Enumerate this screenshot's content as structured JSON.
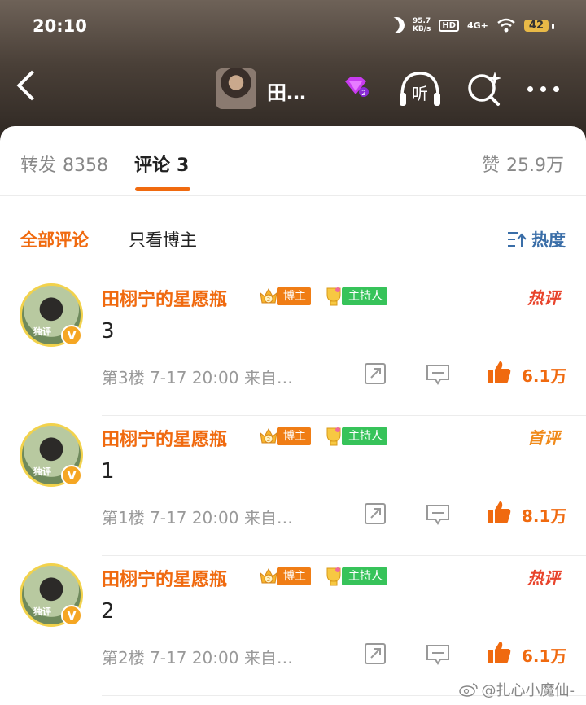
{
  "status_bar": {
    "time": "20:10",
    "net_speed_value": "95.7",
    "net_speed_unit": "KB/s",
    "hd": "HD",
    "signal": "4G+",
    "battery": "42"
  },
  "nav": {
    "title": "田…",
    "icons": [
      "back-icon",
      "diamond-icon",
      "listen-icon",
      "search-icon",
      "more-icon"
    ],
    "listen_label": "听"
  },
  "tabs": {
    "repost_label": "转发",
    "repost_count": "8358",
    "comment_label": "评论",
    "comment_count": "3",
    "like_label": "赞",
    "like_count": "25.9万"
  },
  "filters": {
    "all": "全部评论",
    "owner_only": "只看博主",
    "sort": "热度"
  },
  "comments": [
    {
      "name": "田栩宁的星愿瓶",
      "badge_blogger": "博主",
      "badge_host": "主持人",
      "tag": "热评",
      "tag_color": "#e8442c",
      "body": "3",
      "meta": "第3楼 7-17 20:00 来自…",
      "likes": "6.1万",
      "avatar_text": "独评"
    },
    {
      "name": "田栩宁的星愿瓶",
      "badge_blogger": "博主",
      "badge_host": "主持人",
      "tag": "首评",
      "tag_color": "#f08a1a",
      "body": "1",
      "meta": "第1楼 7-17 20:00 来自…",
      "likes": "8.1万",
      "avatar_text": "独评"
    },
    {
      "name": "田栩宁的星愿瓶",
      "badge_blogger": "博主",
      "badge_host": "主持人",
      "tag": "热评",
      "tag_color": "#e8442c",
      "body": "2",
      "meta": "第2楼 7-17 20:00 来自…",
      "likes": "6.1万",
      "avatar_text": "独评"
    }
  ],
  "watermark": "@扎心小魔仙-",
  "colors": {
    "accent": "#f06a0f",
    "sort_blue": "#3a6ea8",
    "host_green": "#37c35a",
    "blogger_orange": "#f07d15"
  }
}
